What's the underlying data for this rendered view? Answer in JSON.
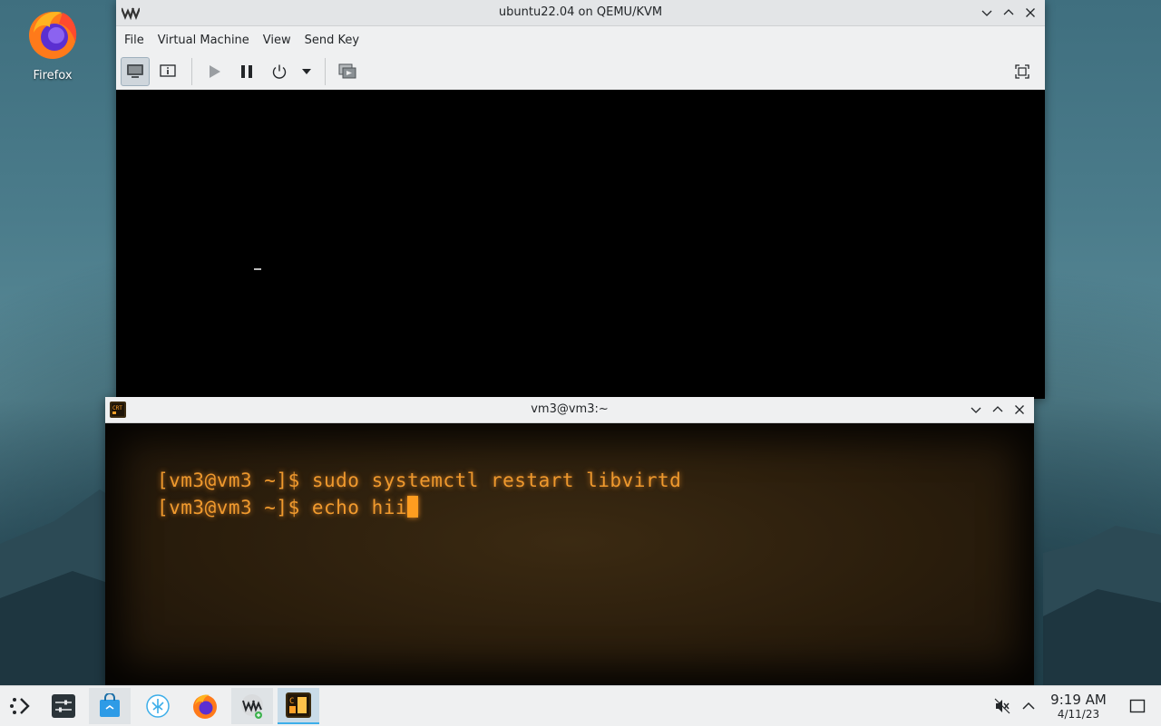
{
  "desktop": {
    "icons": [
      {
        "label": "Firefox",
        "icon": "firefox-icon"
      }
    ]
  },
  "vm_window": {
    "title": "ubuntu22.04 on QEMU/KVM",
    "app_icon": "virt-manager-icon",
    "menu": [
      "File",
      "Virtual Machine",
      "View",
      "Send Key"
    ],
    "toolbar_icons": [
      "console-icon",
      "details-icon",
      "run-icon",
      "pause-icon",
      "power-icon",
      "dropdown-icon",
      "snapshots-icon",
      "fullscreen-icon"
    ]
  },
  "terminal_window": {
    "title": "vm3@vm3:~",
    "app_icon": "cool-retro-term-icon",
    "lines": [
      "[vm3@vm3 ~]$ sudo systemctl restart libvirtd",
      "[vm3@vm3 ~]$ echo hii"
    ]
  },
  "taskbar": {
    "items": [
      {
        "name": "launcher",
        "icon": "application-launcher-icon"
      },
      {
        "name": "system-settings",
        "icon": "settings-icon"
      },
      {
        "name": "discover",
        "icon": "store-icon"
      },
      {
        "name": "kde-app",
        "icon": "kde-icon"
      },
      {
        "name": "firefox",
        "icon": "firefox-icon"
      },
      {
        "name": "virt-manager",
        "icon": "virt-manager-icon"
      },
      {
        "name": "cool-retro-term",
        "icon": "cool-retro-term-icon"
      }
    ],
    "tray": {
      "volume_icon": "volume-muted-icon",
      "expand_icon": "chevron-up-icon",
      "time": "9:19 AM",
      "date": "4/11/23",
      "show_desktop_icon": "show-desktop-icon"
    }
  },
  "colors": {
    "terminal_text": "#f09a2e",
    "accent": "#3daee9"
  }
}
